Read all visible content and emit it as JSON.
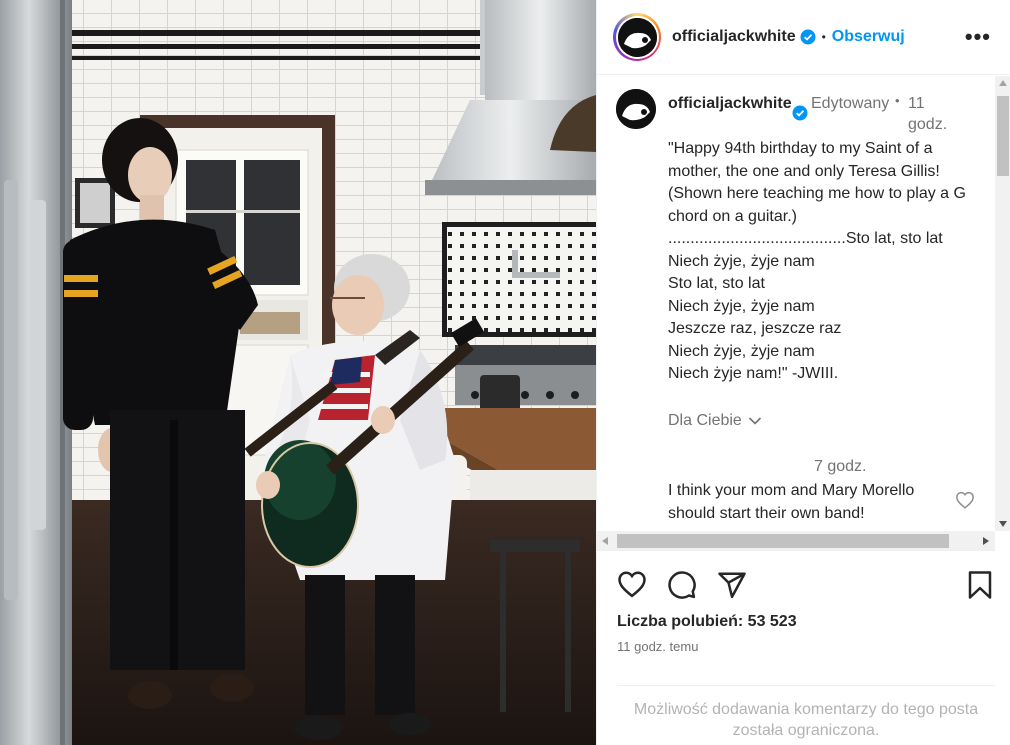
{
  "post": {
    "username": "officialjackwhite",
    "follow_label": "Obserwuj",
    "more_label": "•••",
    "dot": "•"
  },
  "caption": {
    "username": "officialjackwhite",
    "edited_label": "Edytowany",
    "separator": "•",
    "time": "11 godz.",
    "lines": [
      "\"Happy 94th birthday to my Saint of a mother, the one and only Teresa Gillis! (Shown here teaching me how to play a G chord on a guitar.)",
      "........................................Sto lat, sto lat",
      "Niech żyje, żyje nam",
      "Sto lat, sto lat",
      "Niech żyje, żyje nam",
      "Jeszcze raz, jeszcze raz",
      "Niech żyje, żyje nam",
      "Niech żyje nam!\" -JWIII."
    ]
  },
  "for_you_label": "Dla Ciebie",
  "comment": {
    "time": "7 godz.",
    "text": "I think your mom and Mary Morello should start their own band!"
  },
  "likes_label": "Liczba polubień: 53 523",
  "post_time": "11 godz. temu",
  "restricted_text": "Możliwość dodawania komentarzy do tego posta została ograniczona.",
  "colors": {
    "link_blue": "#0095f6",
    "verified_blue": "#0095f6",
    "muted": "#737373",
    "text": "#262626"
  },
  "icons": [
    "verified-badge-icon",
    "chevron-down-icon",
    "heart-icon",
    "comment-icon",
    "share-icon",
    "bookmark-icon",
    "more-icon"
  ]
}
